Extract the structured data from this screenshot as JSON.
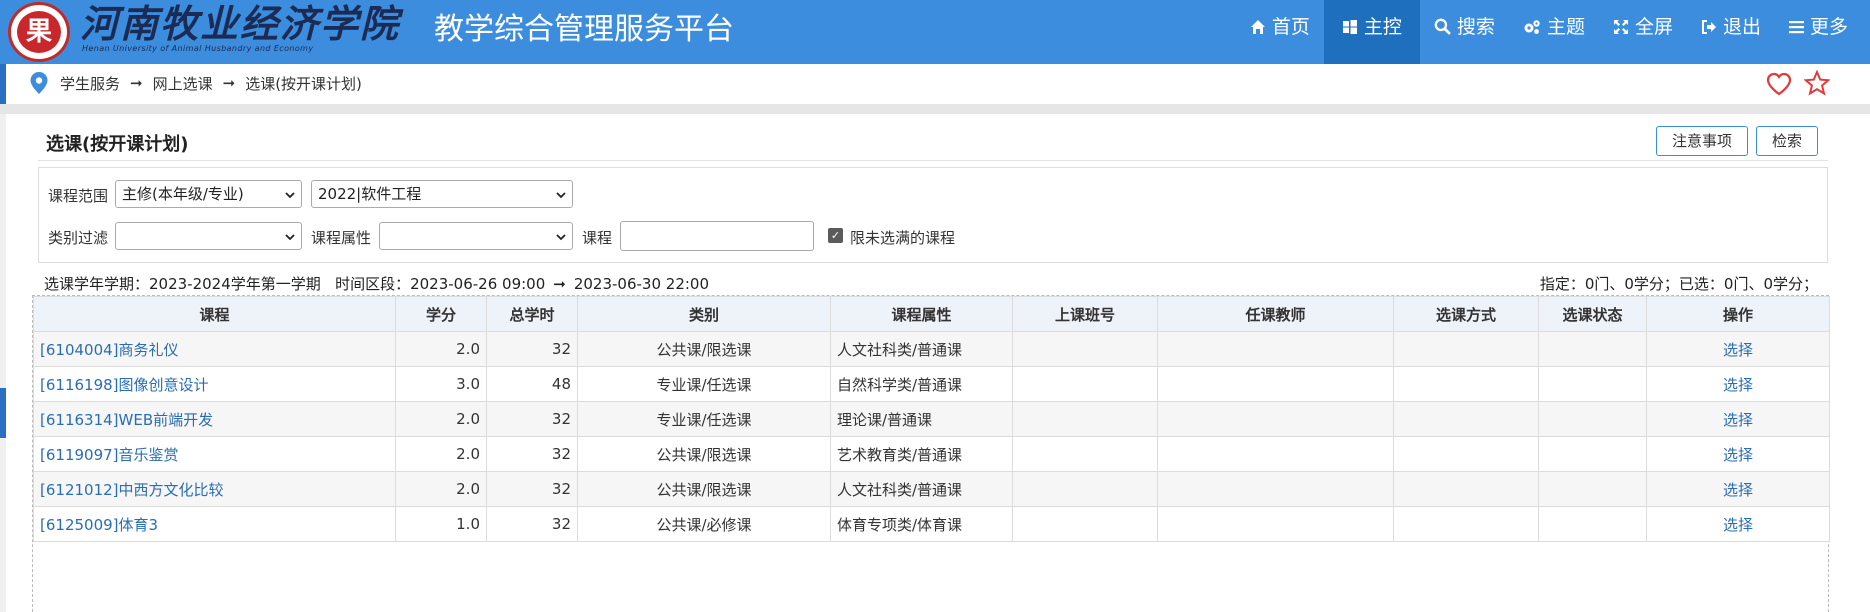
{
  "header": {
    "logo_glyph": "果",
    "school_cn": "河南牧业经济学院",
    "school_en": "Henan University of Animal Husbandry and Economy",
    "platform_title": "教学综合管理服务平台",
    "nav": [
      {
        "label": "首页",
        "icon": "home-icon"
      },
      {
        "label": "主控",
        "icon": "windows-icon"
      },
      {
        "label": "搜索",
        "icon": "search-icon"
      },
      {
        "label": "主题",
        "icon": "gears-icon"
      },
      {
        "label": "全屏",
        "icon": "fullscreen-icon"
      },
      {
        "label": "退出",
        "icon": "logout-icon"
      },
      {
        "label": "更多",
        "icon": "menu-icon"
      }
    ]
  },
  "breadcrumb": [
    "学生服务",
    "网上选课",
    "选课(按开课计划)"
  ],
  "panel": {
    "title": "选课(按开课计划)",
    "notes_button": "注意事项",
    "search_button": "检索"
  },
  "filters": {
    "range_label": "课程范围",
    "range_value": "主修(本年级/专业)",
    "major_value": "2022|软件工程",
    "category_label": "类别过滤",
    "category_value": "",
    "attr_label": "课程属性",
    "attr_value": "",
    "course_label": "课程",
    "course_value": "",
    "limit_label": "限未选满的课程"
  },
  "info": {
    "term": "选课学年学期：2023-2024学年第一学期",
    "period_label": "时间区段：2023-06-26 09:00",
    "period_end": "2023-06-30 22:00",
    "summary": "指定：0门、0学分；已选：0门、0学分；"
  },
  "table": {
    "columns": [
      "课程",
      "学分",
      "总学时",
      "类别",
      "课程属性",
      "上课班号",
      "任课教师",
      "选课方式",
      "选课状态",
      "操作"
    ],
    "rows": [
      {
        "course": "[6104004]商务礼仪",
        "credit": "2.0",
        "hours": "32",
        "type": "公共课/限选课",
        "attr": "人文社科类/普通课",
        "class_no": "",
        "teacher": "",
        "mode": "",
        "status": "",
        "action": "选择"
      },
      {
        "course": "[6116198]图像创意设计",
        "credit": "3.0",
        "hours": "48",
        "type": "专业课/任选课",
        "attr": "自然科学类/普通课",
        "class_no": "",
        "teacher": "",
        "mode": "",
        "status": "",
        "action": "选择"
      },
      {
        "course": "[6116314]WEB前端开发",
        "credit": "2.0",
        "hours": "32",
        "type": "专业课/任选课",
        "attr": "理论课/普通课",
        "class_no": "",
        "teacher": "",
        "mode": "",
        "status": "",
        "action": "选择"
      },
      {
        "course": "[6119097]音乐鉴赏",
        "credit": "2.0",
        "hours": "32",
        "type": "公共课/限选课",
        "attr": "艺术教育类/普通课",
        "class_no": "",
        "teacher": "",
        "mode": "",
        "status": "",
        "action": "选择"
      },
      {
        "course": "[6121012]中西方文化比较",
        "credit": "2.0",
        "hours": "32",
        "type": "公共课/限选课",
        "attr": "人文社科类/普通课",
        "class_no": "",
        "teacher": "",
        "mode": "",
        "status": "",
        "action": "选择"
      },
      {
        "course": "[6125009]体育3",
        "credit": "1.0",
        "hours": "32",
        "type": "公共课/必修课",
        "attr": "体育专项类/体育课",
        "class_no": "",
        "teacher": "",
        "mode": "",
        "status": "",
        "action": "选择"
      }
    ]
  },
  "colors": {
    "header_bg": "#3c8dde",
    "nav_active": "#1f6fbf",
    "link": "#2a6db5",
    "fav": "#e03a3a"
  }
}
